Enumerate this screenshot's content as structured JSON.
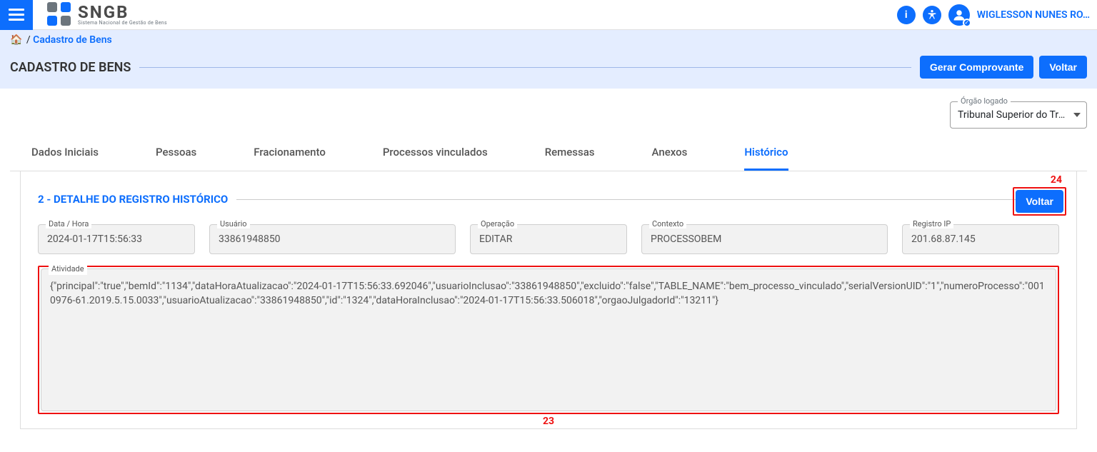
{
  "app": {
    "logo_title": "SNGB",
    "logo_sub": "Sistema Nacional de Gestão de Bens",
    "username": "WIGLESSON NUNES RO…"
  },
  "breadcrumb": {
    "separator": " / ",
    "item": "Cadastro de Bens"
  },
  "header": {
    "title": "CADASTRO DE BENS",
    "gerar_label": "Gerar Comprovante",
    "voltar_label": "Voltar"
  },
  "orgao": {
    "label": "Órgão logado",
    "value": "Tribunal Superior do Tra…"
  },
  "tabs": {
    "dados": "Dados Iniciais",
    "pessoas": "Pessoas",
    "fracionamento": "Fracionamento",
    "processos": "Processos vinculados",
    "remessas": "Remessas",
    "anexos": "Anexos",
    "historico": "Histórico"
  },
  "section": {
    "title": "2 - DETALHE DO REGISTRO HISTÓRICO",
    "voltar": "Voltar",
    "marker24": "24",
    "marker23": "23"
  },
  "fields": {
    "datahora_label": "Data / Hora",
    "datahora_value": "2024-01-17T15:56:33",
    "usuario_label": "Usuário",
    "usuario_value": "33861948850",
    "operacao_label": "Operação",
    "operacao_value": "EDITAR",
    "contexto_label": "Contexto",
    "contexto_value": "PROCESSOBEM",
    "ip_label": "Registro IP",
    "ip_value": "201.68.87.145",
    "atividade_label": "Atividade",
    "atividade_value": "{\"principal\":\"true\",\"bemId\":\"1134\",\"dataHoraAtualizacao\":\"2024-01-17T15:56:33.692046\",\"usuarioInclusao\":\"33861948850\",\"excluido\":\"false\",\"TABLE_NAME\":\"bem_processo_vinculado\",\"serialVersionUID\":\"1\",\"numeroProcesso\":\"0010976-61.2019.5.15.0033\",\"usuarioAtualizacao\":\"33861948850\",\"id\":\"1324\",\"dataHoraInclusao\":\"2024-01-17T15:56:33.506018\",\"orgaoJulgadorId\":\"13211\"}"
  }
}
